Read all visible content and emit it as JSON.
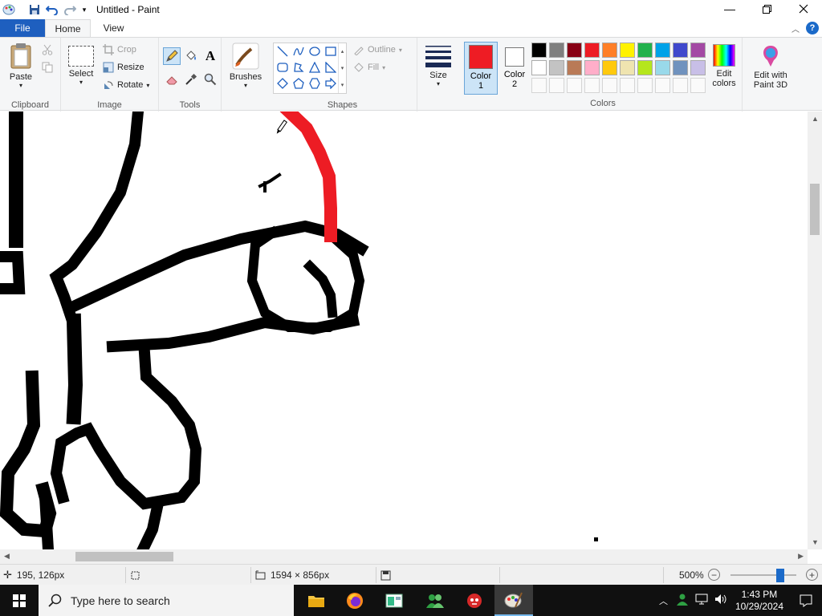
{
  "window": {
    "title": "Untitled - Paint",
    "qat": [
      "paint-app-icon",
      "save-icon",
      "undo-icon",
      "redo-icon",
      "customize-qat-icon"
    ],
    "controls": [
      "minimize-icon",
      "restore-icon",
      "close-icon"
    ]
  },
  "tabs": {
    "file": "File",
    "home": "Home",
    "view": "View"
  },
  "ribbon": {
    "clipboard": {
      "label": "Clipboard",
      "paste": "Paste",
      "cut_icon": "scissors-icon",
      "copy_icon": "copy-icon"
    },
    "image": {
      "label": "Image",
      "select": "Select",
      "crop": "Crop",
      "resize": "Resize",
      "rotate": "Rotate"
    },
    "tools": {
      "label": "Tools",
      "items": [
        "pencil-icon",
        "fill-bucket-icon",
        "text-icon",
        "eraser-icon",
        "color-picker-icon",
        "magnifier-icon"
      ],
      "selected": "pencil-icon"
    },
    "brushes": {
      "label": "Brushes"
    },
    "shapes": {
      "label": "Shapes",
      "outline": "Outline",
      "fill": "Fill",
      "items": [
        "line",
        "curve",
        "oval",
        "rectangle",
        "rounded-rectangle",
        "polygon",
        "triangle",
        "right-triangle",
        "diamond",
        "pentagon",
        "hexagon",
        "right-arrow"
      ]
    },
    "size": {
      "label": "Size"
    },
    "colors": {
      "label": "Colors",
      "color1": "Color 1",
      "color1_value": "#ee1c24",
      "color2": "Color 2",
      "color2_value": "#ffffff",
      "palette_row1": [
        "#000000",
        "#7f7f7f",
        "#880015",
        "#ed1c24",
        "#ff7f27",
        "#fff200",
        "#22b14c",
        "#00a2e8",
        "#3f48cc",
        "#a349a4"
      ],
      "palette_row2": [
        "#ffffff",
        "#c3c3c3",
        "#b97a57",
        "#ffaec9",
        "#ffc90e",
        "#efe4b0",
        "#b5e61d",
        "#99d9ea",
        "#7092be",
        "#c8bfe7"
      ],
      "edit_colors": "Edit colors",
      "paint3d": "Edit with Paint 3D"
    }
  },
  "status": {
    "cursor_pos": "195, 126px",
    "canvas_size": "1594 × 856px",
    "zoom": "500%",
    "zoom_level": 0.75
  },
  "taskbar": {
    "search_placeholder": "Type here to search",
    "apps": [
      "file-explorer-icon",
      "firefox-icon",
      "app-window-icon",
      "people-app-icon",
      "game-icon",
      "paint-icon"
    ],
    "active_app": "paint-icon",
    "time": "1:43 PM",
    "date": "10/29/2024"
  }
}
